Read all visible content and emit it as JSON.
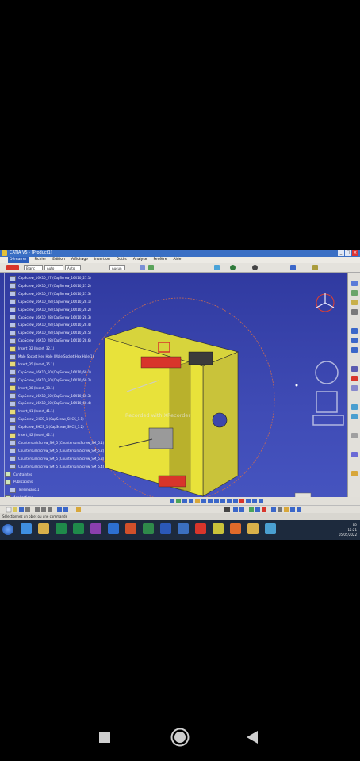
{
  "window": {
    "title": "CATIA V5 - [Product1]",
    "menus": [
      "Démarrer",
      "Fichier",
      "Edition",
      "Affichage",
      "Insertion",
      "Outils",
      "Analyse",
      "Fenêtre",
      "Aide"
    ],
    "active_menu_index": 0,
    "buttons": [
      "_",
      "□",
      "×"
    ]
  },
  "toolbar": {
    "combos": [
      "Blanc",
      "Auto",
      "Auto",
      "Aucun"
    ]
  },
  "tree": {
    "items": [
      {
        "label": "CapScrew_16X10_27 (CapScrew_16X10_27.1)",
        "kind": "part"
      },
      {
        "label": "CapScrew_16X10_27 (CapScrew_16X10_27.2)",
        "kind": "part"
      },
      {
        "label": "CapScrew_16X10_27 (CapScrew_16X10_27.3)",
        "kind": "part"
      },
      {
        "label": "CapScrew_16X10_28 (CapScrew_16X10_28.1)",
        "kind": "part"
      },
      {
        "label": "CapScrew_16X10_28 (CapScrew_16X10_28.2)",
        "kind": "part"
      },
      {
        "label": "CapScrew_16X10_28 (CapScrew_16X10_28.3)",
        "kind": "part"
      },
      {
        "label": "CapScrew_16X10_28 (CapScrew_16X10_28.4)",
        "kind": "part"
      },
      {
        "label": "CapScrew_16X10_28 (CapScrew_16X10_28.5)",
        "kind": "part"
      },
      {
        "label": "CapScrew_16X10_28 (CapScrew_16X10_28.6)",
        "kind": "part"
      },
      {
        "label": "Insert_32 (Insert_32.1)",
        "kind": "asm"
      },
      {
        "label": "Male Socket Hex Hole (Male Socket Hex Hole.1)",
        "kind": "part"
      },
      {
        "label": "Insert_35 (Insert_35.1)",
        "kind": "asm"
      },
      {
        "label": "CapScrew_16X10_60 (CapScrew_16X10_60.1)",
        "kind": "part"
      },
      {
        "label": "CapScrew_16X10_60 (CapScrew_16X10_60.2)",
        "kind": "part"
      },
      {
        "label": "Insert_38 (Insert_38.1)",
        "kind": "asm"
      },
      {
        "label": "CapScrew_16X10_60 (CapScrew_16X10_60.3)",
        "kind": "part"
      },
      {
        "label": "CapScrew_16X10_60 (CapScrew_16X10_60.4)",
        "kind": "part"
      },
      {
        "label": "Insert_41 (Insert_41.1)",
        "kind": "asm"
      },
      {
        "label": "CapScrew_SHCS_1 (CapScrew_SHCS_1.1)",
        "kind": "part"
      },
      {
        "label": "CapScrew_SHCS_1 (CapScrew_SHCS_1.2)",
        "kind": "part"
      },
      {
        "label": "Insert_42 (Insert_42.1)",
        "kind": "asm"
      },
      {
        "label": "CountersunkScrew_SM_5 (CountersunkScrew_SM_5.1)",
        "kind": "part"
      },
      {
        "label": "CountersunkScrew_SM_5 (CountersunkScrew_SM_5.2)",
        "kind": "part"
      },
      {
        "label": "CountersunkScrew_SM_5 (CountersunkScrew_SM_5.3)",
        "kind": "part"
      },
      {
        "label": "CountersunkScrew_SM_5 (CountersunkScrew_SM_5.4)",
        "kind": "part"
      },
      {
        "label": "Contraintes",
        "kind": "folder"
      },
      {
        "label": "Publications",
        "kind": "folder"
      },
      {
        "label": "Teileingang.1",
        "kind": "part"
      },
      {
        "label": "Applications",
        "kind": "folder"
      }
    ]
  },
  "viewport": {
    "watermark": "Recorded with XRecorder",
    "model_colors": {
      "body": "#e8e23a",
      "plate_dark": "#b9b12c",
      "accent_red": "#d8352b",
      "hardware": "#9a9a9a"
    }
  },
  "statusbar": {
    "text": "Sélectionnez un objet ou une commande"
  },
  "taskbar": {
    "apps": [
      "ie-icon",
      "folder-icon",
      "excel-icon",
      "excel-icon",
      "onenote-icon",
      "outlook-icon",
      "powerpoint-icon",
      "project-icon",
      "word-icon",
      "visio-icon",
      "recorder-icon",
      "catia-icon",
      "firefox-icon",
      "explorer-icon",
      "remote-icon"
    ],
    "clock_time": "15:21",
    "clock_date": "05/05/2022",
    "language": "FR"
  },
  "colors": {
    "viewport_bg": "#3a45ae",
    "titlebar": "#3a6fc4"
  }
}
